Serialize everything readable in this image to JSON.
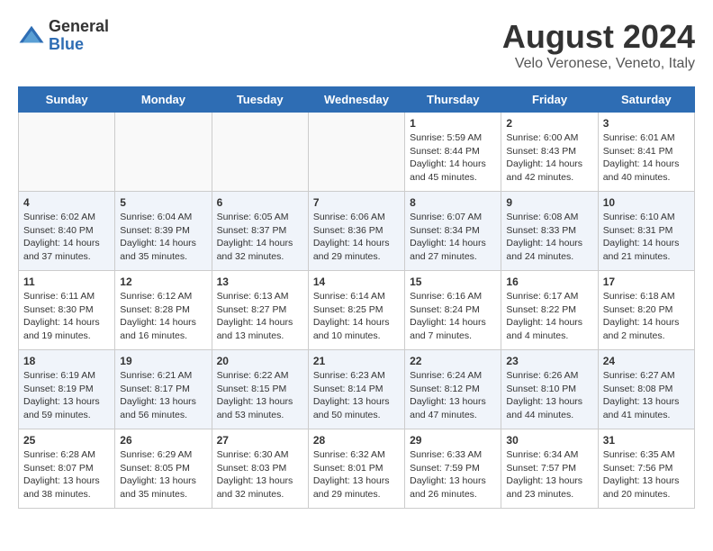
{
  "header": {
    "logo_general": "General",
    "logo_blue": "Blue",
    "title": "August 2024",
    "subtitle": "Velo Veronese, Veneto, Italy"
  },
  "days_of_week": [
    "Sunday",
    "Monday",
    "Tuesday",
    "Wednesday",
    "Thursday",
    "Friday",
    "Saturday"
  ],
  "weeks": [
    [
      {
        "day": "",
        "content": ""
      },
      {
        "day": "",
        "content": ""
      },
      {
        "day": "",
        "content": ""
      },
      {
        "day": "",
        "content": ""
      },
      {
        "day": "1",
        "content": "Sunrise: 5:59 AM\nSunset: 8:44 PM\nDaylight: 14 hours\nand 45 minutes."
      },
      {
        "day": "2",
        "content": "Sunrise: 6:00 AM\nSunset: 8:43 PM\nDaylight: 14 hours\nand 42 minutes."
      },
      {
        "day": "3",
        "content": "Sunrise: 6:01 AM\nSunset: 8:41 PM\nDaylight: 14 hours\nand 40 minutes."
      }
    ],
    [
      {
        "day": "4",
        "content": "Sunrise: 6:02 AM\nSunset: 8:40 PM\nDaylight: 14 hours\nand 37 minutes."
      },
      {
        "day": "5",
        "content": "Sunrise: 6:04 AM\nSunset: 8:39 PM\nDaylight: 14 hours\nand 35 minutes."
      },
      {
        "day": "6",
        "content": "Sunrise: 6:05 AM\nSunset: 8:37 PM\nDaylight: 14 hours\nand 32 minutes."
      },
      {
        "day": "7",
        "content": "Sunrise: 6:06 AM\nSunset: 8:36 PM\nDaylight: 14 hours\nand 29 minutes."
      },
      {
        "day": "8",
        "content": "Sunrise: 6:07 AM\nSunset: 8:34 PM\nDaylight: 14 hours\nand 27 minutes."
      },
      {
        "day": "9",
        "content": "Sunrise: 6:08 AM\nSunset: 8:33 PM\nDaylight: 14 hours\nand 24 minutes."
      },
      {
        "day": "10",
        "content": "Sunrise: 6:10 AM\nSunset: 8:31 PM\nDaylight: 14 hours\nand 21 minutes."
      }
    ],
    [
      {
        "day": "11",
        "content": "Sunrise: 6:11 AM\nSunset: 8:30 PM\nDaylight: 14 hours\nand 19 minutes."
      },
      {
        "day": "12",
        "content": "Sunrise: 6:12 AM\nSunset: 8:28 PM\nDaylight: 14 hours\nand 16 minutes."
      },
      {
        "day": "13",
        "content": "Sunrise: 6:13 AM\nSunset: 8:27 PM\nDaylight: 14 hours\nand 13 minutes."
      },
      {
        "day": "14",
        "content": "Sunrise: 6:14 AM\nSunset: 8:25 PM\nDaylight: 14 hours\nand 10 minutes."
      },
      {
        "day": "15",
        "content": "Sunrise: 6:16 AM\nSunset: 8:24 PM\nDaylight: 14 hours\nand 7 minutes."
      },
      {
        "day": "16",
        "content": "Sunrise: 6:17 AM\nSunset: 8:22 PM\nDaylight: 14 hours\nand 4 minutes."
      },
      {
        "day": "17",
        "content": "Sunrise: 6:18 AM\nSunset: 8:20 PM\nDaylight: 14 hours\nand 2 minutes."
      }
    ],
    [
      {
        "day": "18",
        "content": "Sunrise: 6:19 AM\nSunset: 8:19 PM\nDaylight: 13 hours\nand 59 minutes."
      },
      {
        "day": "19",
        "content": "Sunrise: 6:21 AM\nSunset: 8:17 PM\nDaylight: 13 hours\nand 56 minutes."
      },
      {
        "day": "20",
        "content": "Sunrise: 6:22 AM\nSunset: 8:15 PM\nDaylight: 13 hours\nand 53 minutes."
      },
      {
        "day": "21",
        "content": "Sunrise: 6:23 AM\nSunset: 8:14 PM\nDaylight: 13 hours\nand 50 minutes."
      },
      {
        "day": "22",
        "content": "Sunrise: 6:24 AM\nSunset: 8:12 PM\nDaylight: 13 hours\nand 47 minutes."
      },
      {
        "day": "23",
        "content": "Sunrise: 6:26 AM\nSunset: 8:10 PM\nDaylight: 13 hours\nand 44 minutes."
      },
      {
        "day": "24",
        "content": "Sunrise: 6:27 AM\nSunset: 8:08 PM\nDaylight: 13 hours\nand 41 minutes."
      }
    ],
    [
      {
        "day": "25",
        "content": "Sunrise: 6:28 AM\nSunset: 8:07 PM\nDaylight: 13 hours\nand 38 minutes."
      },
      {
        "day": "26",
        "content": "Sunrise: 6:29 AM\nSunset: 8:05 PM\nDaylight: 13 hours\nand 35 minutes."
      },
      {
        "day": "27",
        "content": "Sunrise: 6:30 AM\nSunset: 8:03 PM\nDaylight: 13 hours\nand 32 minutes."
      },
      {
        "day": "28",
        "content": "Sunrise: 6:32 AM\nSunset: 8:01 PM\nDaylight: 13 hours\nand 29 minutes."
      },
      {
        "day": "29",
        "content": "Sunrise: 6:33 AM\nSunset: 7:59 PM\nDaylight: 13 hours\nand 26 minutes."
      },
      {
        "day": "30",
        "content": "Sunrise: 6:34 AM\nSunset: 7:57 PM\nDaylight: 13 hours\nand 23 minutes."
      },
      {
        "day": "31",
        "content": "Sunrise: 6:35 AM\nSunset: 7:56 PM\nDaylight: 13 hours\nand 20 minutes."
      }
    ]
  ]
}
